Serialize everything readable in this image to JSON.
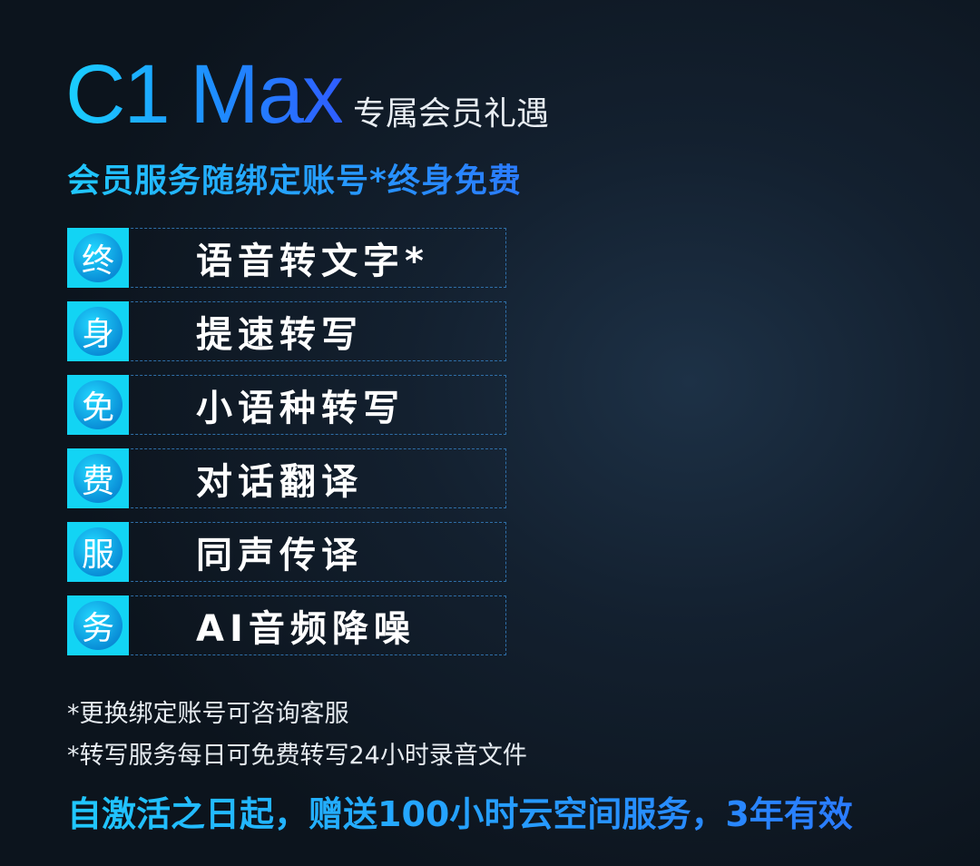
{
  "header": {
    "model": "C1 Max",
    "subtitle": "专属会员礼遇",
    "tagline": "会员服务随绑定账号*终身免费"
  },
  "features": [
    {
      "badge": "终",
      "label": "语音转文字*"
    },
    {
      "badge": "身",
      "label": "提速转写"
    },
    {
      "badge": "免",
      "label": "小语种转写"
    },
    {
      "badge": "费",
      "label": "对话翻译"
    },
    {
      "badge": "服",
      "label": "同声传译"
    },
    {
      "badge": "务",
      "label": "AI音频降噪"
    }
  ],
  "notes": [
    "*更换绑定账号可咨询客服",
    "*转写服务每日可免费转写24小时录音文件"
  ],
  "bottom": "自激活之日起，赠送100小时云空间服务，3年有效",
  "colors": {
    "accent_cyan": "#1ad0ff",
    "accent_blue": "#2a7bff",
    "badge_bg": "#12d4f4",
    "background": "#13202f"
  }
}
